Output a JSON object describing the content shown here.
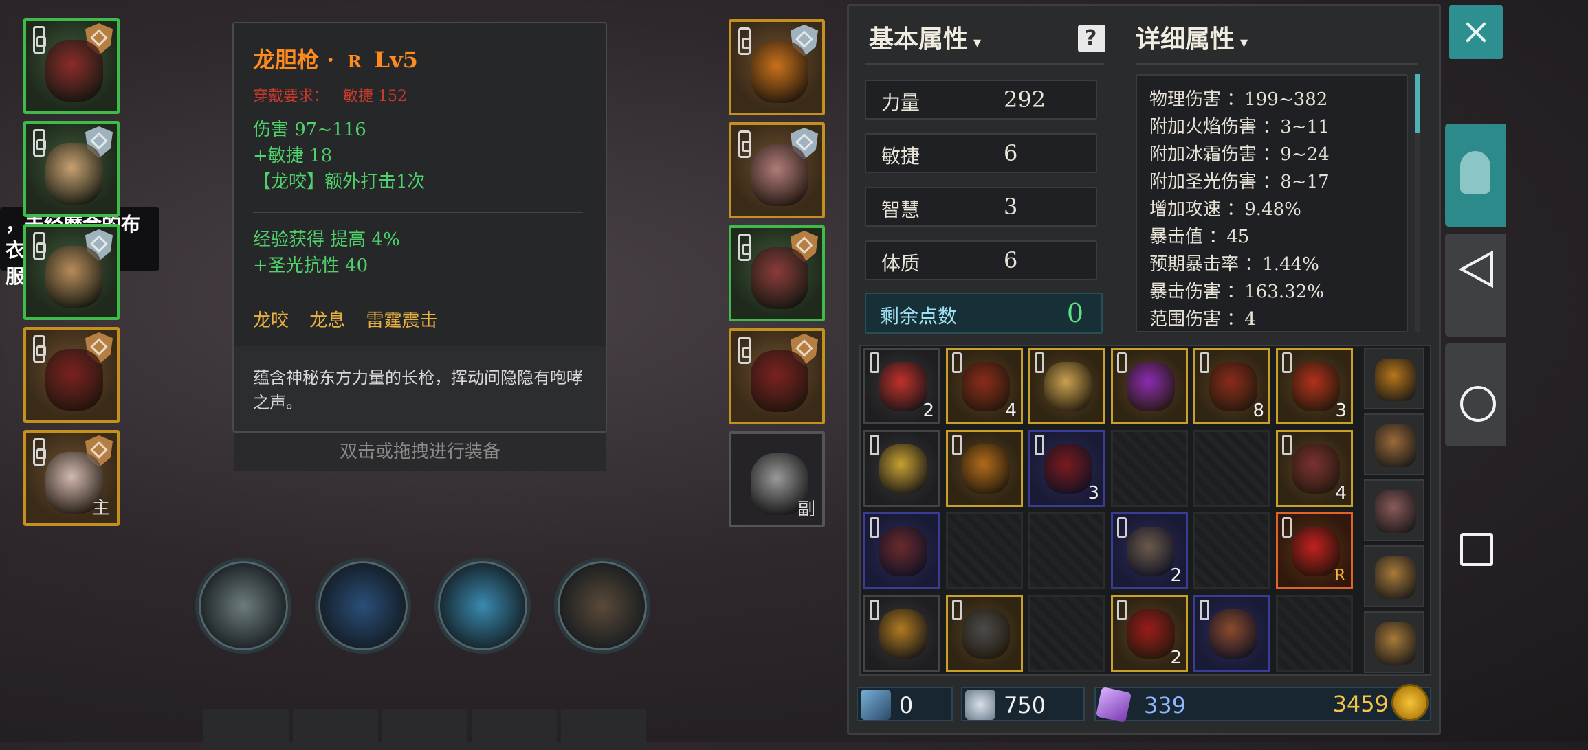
{
  "popup": {
    "line1": "，未经磨合的布衣",
    "line2": "服侍"
  },
  "left_equipment": [
    {
      "name": "helmet-slot",
      "rarity": "green",
      "shield": "bronze",
      "tag": "",
      "color": "#8a2a2a"
    },
    {
      "name": "armor-slot",
      "rarity": "green",
      "shield": "silver",
      "tag": "",
      "color": "#c8a070"
    },
    {
      "name": "pants-slot",
      "rarity": "green",
      "shield": "silver",
      "tag": "",
      "color": "#b98a5a"
    },
    {
      "name": "ring-slot",
      "rarity": "gold",
      "shield": "bronze",
      "tag": "",
      "color": "#7a2020"
    },
    {
      "name": "main-weapon-slot",
      "rarity": "gold",
      "shield": "bronze",
      "tag": "主",
      "color": "#d0b8b0"
    }
  ],
  "right_equipment": [
    {
      "name": "amulet-slot",
      "rarity": "gold",
      "shield": "silver",
      "tag": "",
      "color": "#c8701a"
    },
    {
      "name": "gloves-slot",
      "rarity": "gold",
      "shield": "silver",
      "tag": "",
      "color": "#b07a7a"
    },
    {
      "name": "boots-slot",
      "rarity": "green",
      "shield": "bronze",
      "tag": "",
      "color": "#8a3a3a"
    },
    {
      "name": "ring2-slot",
      "rarity": "gold",
      "shield": "bronze",
      "tag": "",
      "color": "#7a2020"
    },
    {
      "name": "offhand-slot",
      "rarity": "plain",
      "shield": "",
      "tag": "副",
      "color": "#9a9a9a"
    }
  ],
  "tooltip": {
    "title": "龙胆枪 ·",
    "rarity": "R",
    "level": "Lv5",
    "requirement_label": "穿戴要求：",
    "requirement_value": "敏捷 152",
    "lines": [
      "伤害   97~116",
      "+敏捷 18",
      "【龙咬】额外打击1次"
    ],
    "bonus_lines": [
      "经验获得 提高 4%",
      "+圣光抗性 40"
    ],
    "skills": "龙咬 龙息 雷霆震击",
    "description": "蕴含神秘东方力量的长枪，挥动间隐隐有咆哮之声。"
  },
  "equip_hint": "双击或拖拽进行装备",
  "skills": [
    {
      "name": "slash-skill",
      "color": "#6e7c7e"
    },
    {
      "name": "whirl-skill",
      "color": "#2a4f7a"
    },
    {
      "name": "wave-skill",
      "color": "#3a8ab0"
    },
    {
      "name": "charge-skill",
      "color": "#5a4a3a"
    }
  ],
  "stats_panel": {
    "basic_title": "基本属性",
    "detail_title": "详细属性",
    "basic": [
      {
        "label": "力量",
        "value": "292"
      },
      {
        "label": "敏捷",
        "value": "6"
      },
      {
        "label": "智慧",
        "value": "3"
      },
      {
        "label": "体质",
        "value": "6"
      }
    ],
    "remaining_label": "剩余点数",
    "remaining_value": "0",
    "details": [
      "物理伤害 ：199~382",
      "附加火焰伤害 ：3~11",
      "附加冰霜伤害 ：9~24",
      "附加圣光伤害 ：8~17",
      "增加攻速 ：9.48%",
      "暴击值 ：45",
      "预期暴击率 ：1.44%",
      "暴击伤害 ：163.32%",
      "范围伤害 ：4"
    ]
  },
  "inventory": [
    [
      {
        "q": "dark",
        "count": "2",
        "tag": "",
        "color": "#c0302a"
      },
      {
        "q": "gold",
        "count": "4",
        "tag": "",
        "color": "#8a2a1a"
      },
      {
        "q": "gold",
        "count": "",
        "tag": "",
        "color": "#c8a050"
      },
      {
        "q": "gold",
        "count": "",
        "tag": "",
        "color": "#8a2ab0"
      },
      {
        "q": "gold",
        "count": "8",
        "tag": "",
        "color": "#8a2a1a"
      },
      {
        "q": "gold",
        "count": "3",
        "tag": "",
        "color": "#b0301a"
      }
    ],
    [
      {
        "q": "dark",
        "count": "",
        "tag": "",
        "color": "#c8a030"
      },
      {
        "q": "gold",
        "count": "",
        "tag": "",
        "color": "#b06a1a"
      },
      {
        "q": "purple",
        "count": "3",
        "tag": "",
        "color": "#7a1a1a"
      },
      {
        "q": "empty",
        "count": "",
        "tag": "",
        "color": ""
      },
      {
        "q": "empty",
        "count": "",
        "tag": "",
        "color": ""
      },
      {
        "q": "gold",
        "count": "4",
        "tag": "",
        "color": "#7a3030"
      }
    ],
    [
      {
        "q": "purple",
        "count": "",
        "tag": "",
        "color": "#6a2a2a"
      },
      {
        "q": "empty",
        "count": "",
        "tag": "",
        "color": ""
      },
      {
        "q": "empty",
        "count": "",
        "tag": "",
        "color": ""
      },
      {
        "q": "purple",
        "count": "2",
        "tag": "",
        "color": "#6a5a4a"
      },
      {
        "q": "empty",
        "count": "",
        "tag": "",
        "color": ""
      },
      {
        "q": "orange",
        "count": "",
        "tag": "R",
        "color": "#c02020"
      }
    ],
    [
      {
        "q": "dark",
        "count": "",
        "tag": "",
        "color": "#b07a20"
      },
      {
        "q": "gold",
        "count": "",
        "tag": "",
        "color": "#4a4a4a"
      },
      {
        "q": "empty",
        "count": "",
        "tag": "",
        "color": ""
      },
      {
        "q": "gold",
        "count": "2",
        "tag": "",
        "color": "#9a1a1a"
      },
      {
        "q": "purple",
        "count": "",
        "tag": "",
        "color": "#8a4a2a"
      },
      {
        "q": "empty",
        "count": "",
        "tag": "",
        "color": ""
      }
    ]
  ],
  "bags": [
    {
      "color": "#b8761a"
    },
    {
      "color": "#9a6a3a"
    },
    {
      "color": "#8a5a5a"
    },
    {
      "color": "#a87a3a"
    },
    {
      "color": "#a87a3a"
    }
  ],
  "currency": {
    "scroll": "0",
    "hearts": "750",
    "gems": "339",
    "gold": "3459"
  },
  "colors": {
    "accent": "#2d8f8f",
    "legendary": "#ff8a1e",
    "green_stat": "#4fd06a",
    "requirement": "#c83a2c"
  }
}
